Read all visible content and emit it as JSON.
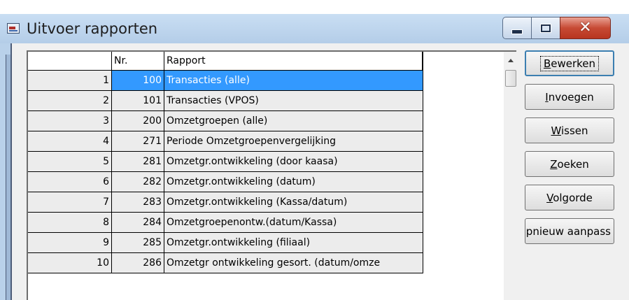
{
  "window": {
    "title": "Uitvoer rapporten",
    "controls": {
      "minimize": "minimize",
      "maximize": "maximize",
      "close": "close"
    }
  },
  "grid": {
    "columns": [
      "",
      "Nr.",
      "Rapport"
    ],
    "selected_row": 1,
    "rows": [
      {
        "index": "1",
        "nr": "100",
        "rapport": "Transacties (alle)"
      },
      {
        "index": "2",
        "nr": "101",
        "rapport": "Transacties (VPOS)"
      },
      {
        "index": "3",
        "nr": "200",
        "rapport": "Omzetgroepen (alle)"
      },
      {
        "index": "4",
        "nr": "271",
        "rapport": "Periode Omzetgroepenvergelijking"
      },
      {
        "index": "5",
        "nr": "281",
        "rapport": "Omzetgr.ontwikkeling (door kaasa)"
      },
      {
        "index": "6",
        "nr": "282",
        "rapport": "Omzetgr.ontwikkeling (datum)"
      },
      {
        "index": "7",
        "nr": "283",
        "rapport": "Omzetgr.ontwikkeling (Kassa/datum)"
      },
      {
        "index": "8",
        "nr": "284",
        "rapport": "Omzetgroepenontw.(datum/Kassa)"
      },
      {
        "index": "9",
        "nr": "285",
        "rapport": "Omzetgr.ontwikkeling (filiaal)"
      },
      {
        "index": "10",
        "nr": "286",
        "rapport": "Omzetgr ontwikkeling gesort. (datum/omze"
      }
    ]
  },
  "buttons": {
    "edit": {
      "hotkey": "B",
      "rest": "ewerken"
    },
    "insert": {
      "hotkey": "I",
      "rest": "nvoegen"
    },
    "delete": {
      "pre": "",
      "hotkey": "W",
      "rest": "issen"
    },
    "search": {
      "hotkey": "Z",
      "rest": "oeken"
    },
    "order": {
      "hotkey": "V",
      "rest": "olgorde"
    },
    "customize": {
      "label": "pnieuw aanpass"
    }
  },
  "colors": {
    "selection": "#3399ff",
    "titlebar": "#b9d1ea",
    "close": "#c74a34"
  },
  "icons": {
    "app": "report-app-icon",
    "scroll_up": "arrow-up-icon"
  }
}
